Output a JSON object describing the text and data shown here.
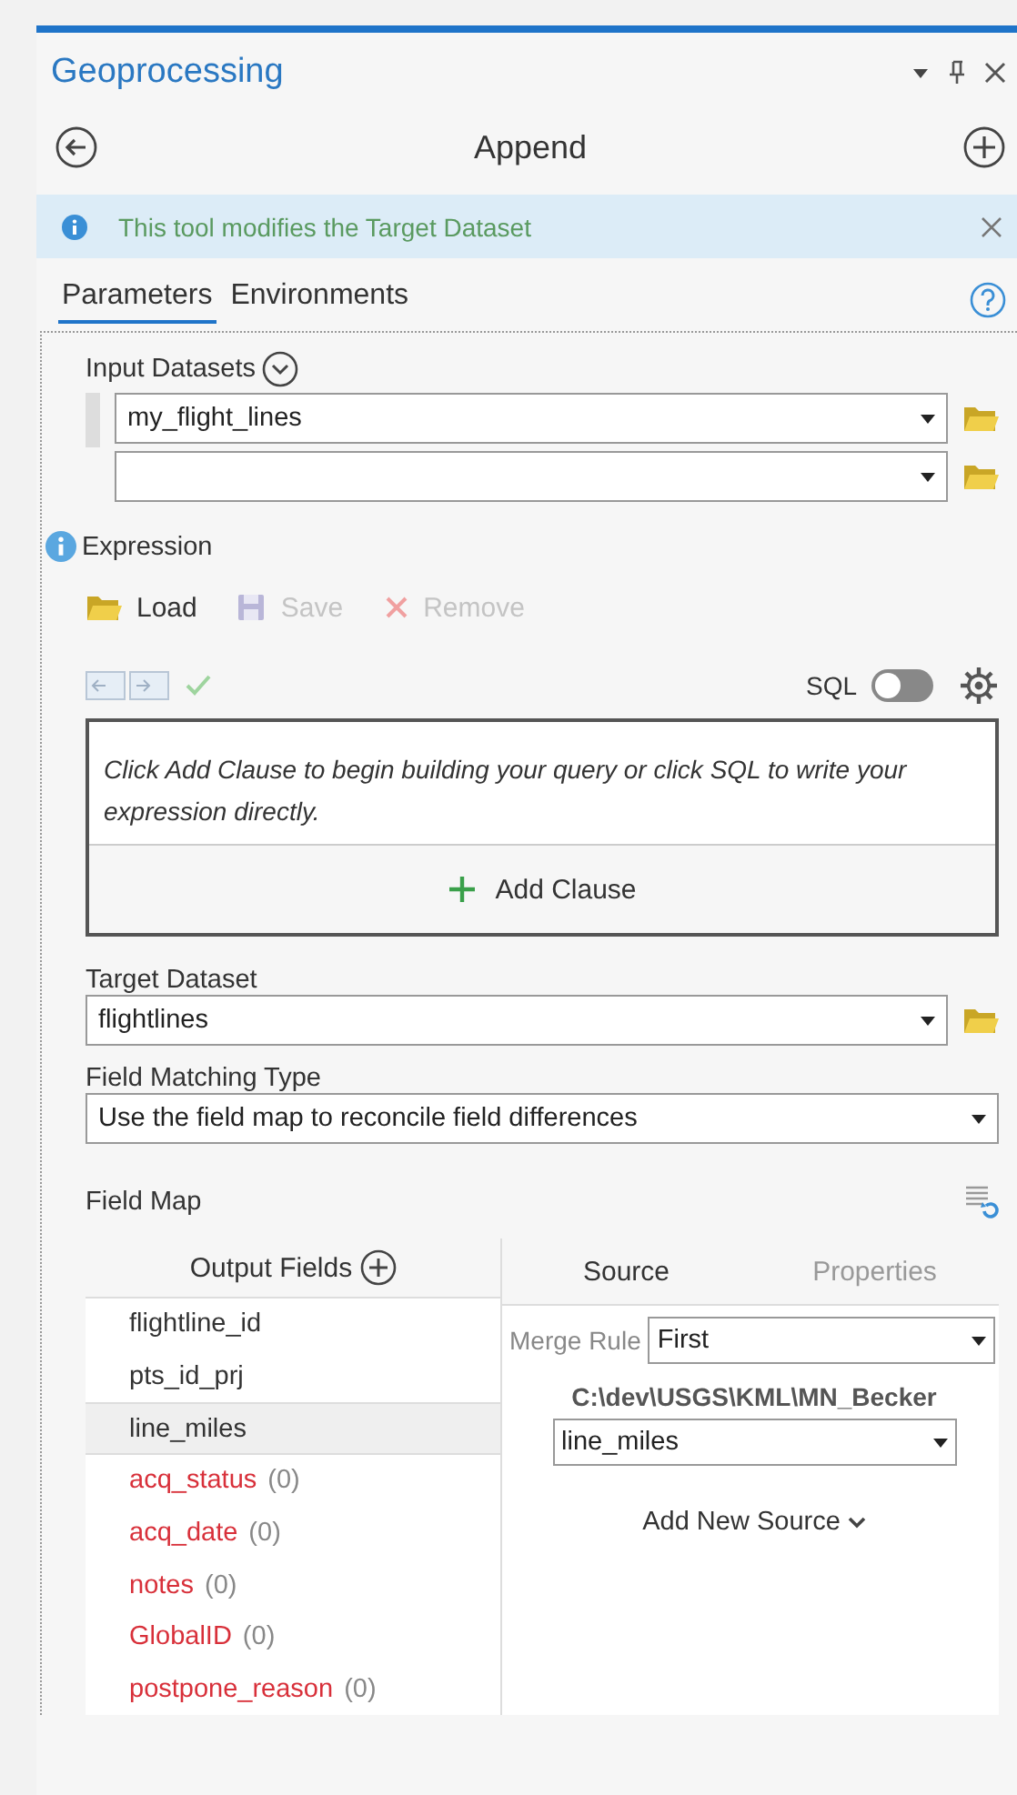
{
  "pane": {
    "title": "Geoprocessing"
  },
  "tool": {
    "title": "Append"
  },
  "notice": {
    "text": "This tool modifies the Target Dataset"
  },
  "tabs": [
    {
      "label": "Parameters",
      "selected": true
    },
    {
      "label": "Environments",
      "selected": false
    }
  ],
  "input_datasets": {
    "label": "Input Datasets",
    "rows": [
      {
        "kind": "filled",
        "value": "my_flight_lines"
      },
      {
        "kind": "blank"
      }
    ]
  },
  "expression": {
    "label": "Expression",
    "actions": [
      {
        "kind": "load",
        "label": "Load",
        "disabled": false
      },
      {
        "kind": "save",
        "label": "Save",
        "disabled": true
      },
      {
        "kind": "remove",
        "label": "Remove",
        "disabled": true
      }
    ],
    "sql_label": "SQL",
    "sql_on": false,
    "hint": "Click Add Clause to begin building your query or click SQL to write your expression directly.",
    "add_clause": "Add Clause"
  },
  "target_dataset": {
    "label": "Target Dataset",
    "value": "flightlines"
  },
  "field_matching": {
    "label": "Field Matching Type",
    "value": "Use the field map to reconcile field differences"
  },
  "field_map": {
    "label": "Field Map",
    "output_header": "Output Fields",
    "side_tabs": [
      {
        "label": "Source",
        "selected": true
      },
      {
        "label": "Properties",
        "selected": false
      }
    ],
    "fields": [
      {
        "name": "flightline_id",
        "kind": "matched",
        "selected": false
      },
      {
        "name": "pts_id_prj",
        "kind": "matched",
        "selected": false
      },
      {
        "name": "line_miles",
        "kind": "matched",
        "selected": true
      },
      {
        "name": "acq_status",
        "kind": "unmatched",
        "count": "(0)",
        "selected": false
      },
      {
        "name": "acq_date",
        "kind": "unmatched",
        "count": "(0)",
        "selected": false
      },
      {
        "name": "notes",
        "kind": "unmatched",
        "count": "(0)",
        "selected": false
      },
      {
        "name": "GlobalID",
        "kind": "unmatched",
        "count": "(0)",
        "selected": false
      },
      {
        "name": "postpone_reason",
        "kind": "unmatched",
        "count": "(0)",
        "selected": false
      }
    ],
    "merge_rule_label": "Merge Rule",
    "merge_rule": "First",
    "source_path": "C:\\dev\\USGS\\KML\\MN_Becker",
    "source_field": "line_miles",
    "add_source": "Add New Source"
  }
}
